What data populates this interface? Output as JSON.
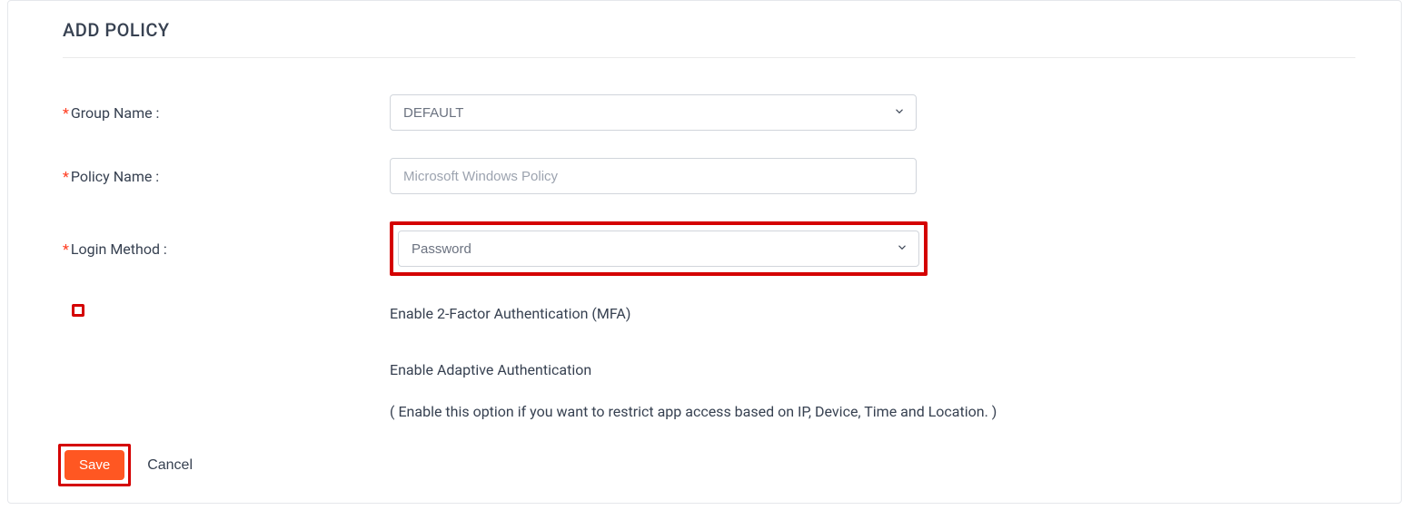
{
  "page": {
    "title": "ADD POLICY"
  },
  "form": {
    "groupName": {
      "label": "Group Name :",
      "value": "DEFAULT"
    },
    "policyName": {
      "label": "Policy Name :",
      "placeholder": "Microsoft Windows Policy",
      "value": ""
    },
    "loginMethod": {
      "label": "Login Method :",
      "value": "Password"
    },
    "mfa": {
      "label": "Enable 2-Factor Authentication (MFA)",
      "enabled": true
    },
    "adaptive": {
      "label": "Enable Adaptive Authentication",
      "helper": "( Enable this option if you want to restrict app access based on IP, Device, Time and Location. )",
      "enabled": false
    }
  },
  "actions": {
    "save": "Save",
    "cancel": "Cancel"
  }
}
